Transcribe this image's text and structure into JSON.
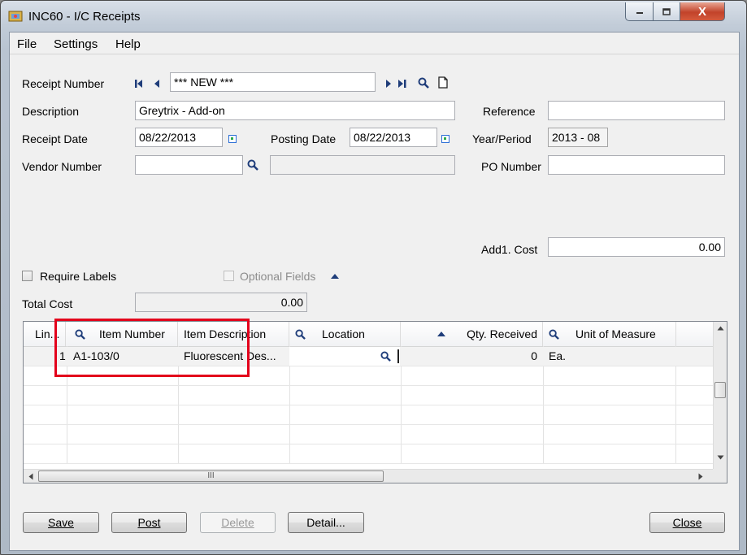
{
  "window": {
    "title": "INC60 - I/C Receipts",
    "close_glyph": "X"
  },
  "menu": {
    "file": "File",
    "settings": "Settings",
    "help": "Help"
  },
  "form": {
    "receipt_number_label": "Receipt Number",
    "receipt_number_value": "*** NEW ***",
    "description_label": "Description",
    "description_value": "Greytrix - Add-on",
    "reference_label": "Reference",
    "reference_value": "",
    "receipt_date_label": "Receipt Date",
    "receipt_date_value": "08/22/2013",
    "posting_date_label": "Posting Date",
    "posting_date_value": "08/22/2013",
    "year_period_label": "Year/Period",
    "year_period_value": "2013 - 08",
    "vendor_number_label": "Vendor Number",
    "vendor_number_value": "",
    "vendor_name_value": "",
    "po_number_label": "PO Number",
    "po_number_value": "",
    "addl_cost_label": "Add1. Cost",
    "addl_cost_value": "0.00",
    "require_labels_label": "Require Labels",
    "optional_fields_label": "Optional Fields",
    "total_cost_label": "Total Cost",
    "total_cost_value": "0.00"
  },
  "grid": {
    "columns": [
      "Lin...",
      "Item Number",
      "Item Description",
      "Location",
      "Qty. Received",
      "Unit of Measure"
    ],
    "rows": [
      {
        "line": "1",
        "item_number": "A1-103/0",
        "item_description": "Fluorescent Des...",
        "location": "",
        "qty_received": "0",
        "unit_of_measure": "Ea."
      }
    ],
    "hscroll_grip": "III"
  },
  "buttons": {
    "save": "Save",
    "post": "Post",
    "delete": "Delete",
    "detail": "Detail...",
    "close": "Close"
  },
  "colors": {
    "highlight_box": "#e3001b",
    "calendar_icon": "#2c6fd6"
  }
}
